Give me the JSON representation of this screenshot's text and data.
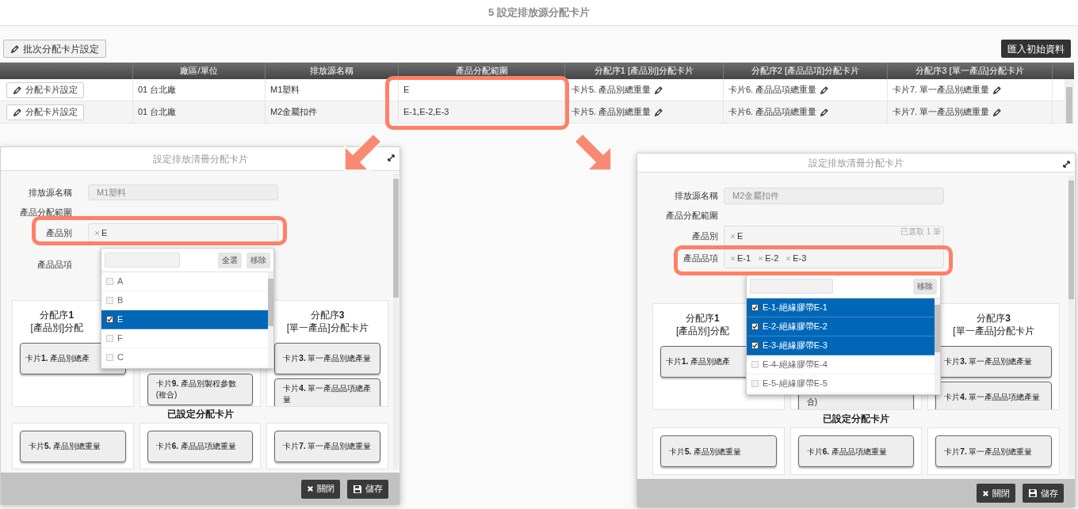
{
  "page_title": "5 設定排放源分配卡片",
  "toolbar": {
    "batch_button": "批次分配卡片設定",
    "import_button": "匯入初始資料"
  },
  "table": {
    "columns": [
      "廠區/單位",
      "排放源名稱",
      "產品分配範圍",
      "分配序1 [產品別]分配卡片",
      "分配序2 [產品品項]分配卡片",
      "分配序3 [單一產品]分配卡片"
    ],
    "rows": [
      {
        "action": "分配卡片設定",
        "site": "01 台北廠",
        "source": "M1塑料",
        "range": "E",
        "card_1": "卡片5. 產品別總重量",
        "card_2": "卡片6. 產品品項總重量",
        "card_3": "卡片7. 單一產品別總重量"
      },
      {
        "action": "分配卡片設定",
        "site": "01 台北廠",
        "source": "M2金屬扣件",
        "range": "E-1,E-2,E-3",
        "card_1": "卡片5. 產品別總重量",
        "card_2": "卡片6. 產品品項總重量",
        "card_3": "卡片7. 單一產品別總重量"
      }
    ]
  },
  "dialogs": [
    {
      "title": "設定排放清冊分配卡片",
      "fields": [
        {
          "kind": "text",
          "label": "排放源名稱",
          "value": "M1塑料"
        },
        {
          "kind": "heading",
          "label": "產品分配範圍"
        },
        {
          "kind": "chips",
          "label": "產品別",
          "chips": [
            "E"
          ]
        },
        {
          "kind": "chips",
          "label": "產品品項"
        }
      ],
      "dropdown": {
        "buttons": [
          "全選",
          "移除"
        ],
        "options": [
          {
            "label": "A",
            "selected": false
          },
          {
            "label": "B",
            "selected": false
          },
          {
            "label": "E",
            "selected": true
          },
          {
            "label": "F",
            "selected": false
          },
          {
            "label": "C",
            "selected": false
          }
        ]
      },
      "columns": [
        {
          "heading": [
            "分配序**1**",
            "[產品別]分配"
          ],
          "cards": [
            "卡片**1.** 產品別總產"
          ]
        },
        {
          "cards": [
            "卡片**9.** 產品別製程參數(複合)"
          ]
        },
        {
          "heading": [
            "分配序**3**",
            "[單一產品]分配卡片"
          ],
          "cards": [
            "卡片**3.** 單一產品別總產量",
            "卡片**4.** 單一產品品項總產量"
          ]
        }
      ],
      "set_heading": "已設定分配卡片",
      "set_cards": [
        "卡片**5.** 產品別總重量",
        "卡片**6.** 產品品項總重量",
        "卡片**7.** 單一產品別總重量"
      ],
      "buttons": [
        {
          "kind": "close",
          "label": "關閉"
        },
        {
          "kind": "save",
          "label": "儲存"
        }
      ]
    },
    {
      "title": "設定排放清冊分配卡片",
      "fields": [
        {
          "kind": "text",
          "label": "排放源名稱",
          "value": "M2金屬扣件"
        },
        {
          "kind": "heading",
          "label": "產品分配範圍"
        },
        {
          "kind": "chips",
          "label": "產品別",
          "chips": [
            "E"
          ],
          "hint": "已選取 1 筆"
        },
        {
          "kind": "chips",
          "label": "產品品項",
          "chips": [
            "E-1",
            "E-2",
            "E-3"
          ]
        }
      ],
      "dropdown": {
        "buttons": [
          "移除"
        ],
        "options": [
          {
            "label": "E-1-絕緣膠帶E-1",
            "selected": true
          },
          {
            "label": "E-2-絕緣膠帶E-2",
            "selected": true
          },
          {
            "label": "E-3-絕緣膠帶E-3",
            "selected": true
          },
          {
            "label": "E-4-絕緣膠帶E-4",
            "selected": false
          },
          {
            "label": "E-5-絕緣膠帶E-5",
            "selected": false
          }
        ]
      },
      "columns": [
        {
          "heading": [
            "分配序**1**",
            "[產品別]分配"
          ],
          "cards": [
            "卡片**1.** 產品別總產"
          ]
        },
        {
          "cards": [
            "合)"
          ]
        },
        {
          "heading": [
            "分配序**3**",
            "[單一產品]分配卡片"
          ],
          "cards": [
            "卡片**3.** 單一產品別總產量",
            "卡片**4.** 單一產品品項總產量"
          ]
        }
      ],
      "set_heading": "已設定分配卡片",
      "set_cards": [
        "卡片**5.** 產品別總重量",
        "卡片**6.** 產品品項總重量",
        "卡片**7.** 單一產品別總重量"
      ],
      "buttons": [
        {
          "kind": "close",
          "label": "關閉"
        },
        {
          "kind": "save",
          "label": "儲存"
        }
      ]
    }
  ]
}
